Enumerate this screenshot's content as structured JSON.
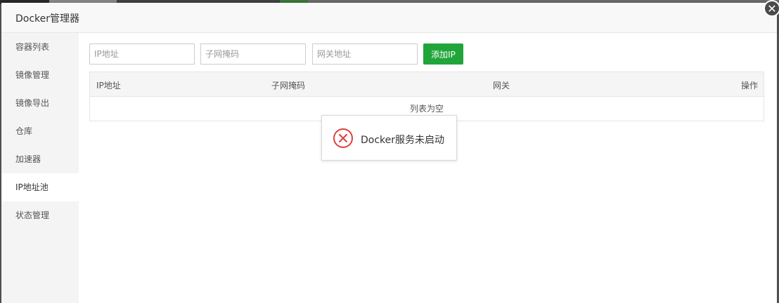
{
  "dialog": {
    "title": "Docker管理器",
    "close_icon": "close-icon"
  },
  "sidebar": {
    "items": [
      {
        "label": "容器列表",
        "active": false
      },
      {
        "label": "镜像管理",
        "active": false
      },
      {
        "label": "镜像导出",
        "active": false
      },
      {
        "label": "仓库",
        "active": false
      },
      {
        "label": "加速器",
        "active": false
      },
      {
        "label": "IP地址池",
        "active": true
      },
      {
        "label": "状态管理",
        "active": false
      }
    ]
  },
  "toolbar": {
    "ip_placeholder": "IP地址",
    "ip_value": "",
    "mask_placeholder": "子网掩码",
    "mask_value": "",
    "gateway_placeholder": "网关地址",
    "gateway_value": "",
    "add_label": "添加IP"
  },
  "table": {
    "headers": [
      "IP地址",
      "子网掩码",
      "网关",
      "操作"
    ],
    "empty_text": "列表为空"
  },
  "toast": {
    "icon": "error-circle-icon",
    "message": "Docker服务未启动"
  },
  "colors": {
    "accent": "#20a53a",
    "error": "#e04040"
  }
}
